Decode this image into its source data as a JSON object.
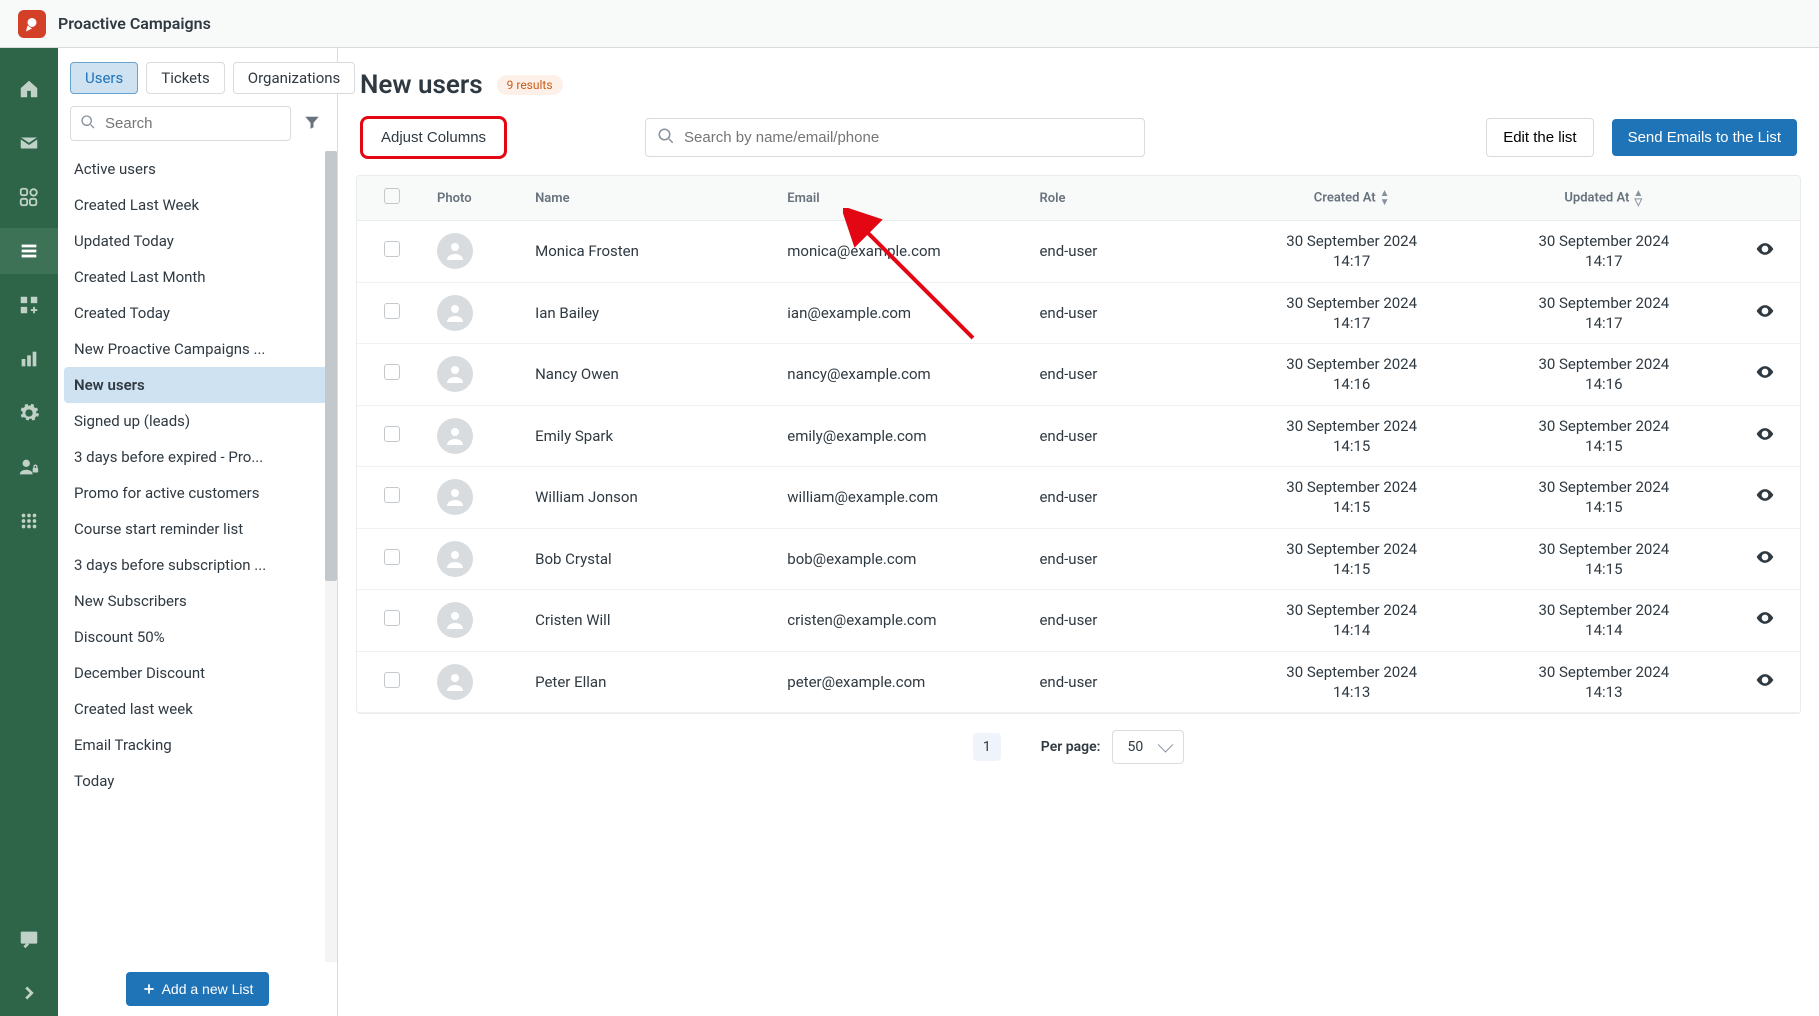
{
  "header": {
    "app_title": "Proactive Campaigns"
  },
  "sidebar": {
    "tabs": [
      "Users",
      "Tickets",
      "Organizations"
    ],
    "active_tab_index": 0,
    "search_placeholder": "Search",
    "add_list_label": "Add a new List",
    "items": [
      "Active users",
      "Created Last Week",
      "Updated Today",
      "Created Last Month",
      "Created Today",
      "New Proactive Campaigns ...",
      "New users",
      "Signed up (leads)",
      "3 days before expired - Pro...",
      "Promo for active customers",
      "Course start reminder list",
      "3 days before subscription ...",
      "New Subscribers",
      "Discount 50%",
      "December Discount",
      "Created last week",
      "Email Tracking",
      "Today"
    ],
    "selected_index": 6
  },
  "main": {
    "title": "New users",
    "result_badge": "9 results",
    "adjust_columns": "Adjust Columns",
    "search_placeholder": "Search by name/email/phone",
    "edit_list": "Edit the list",
    "send_emails": "Send Emails to the List",
    "columns": {
      "photo": "Photo",
      "name": "Name",
      "email": "Email",
      "role": "Role",
      "created": "Created At",
      "updated": "Updated At"
    },
    "rows": [
      {
        "name": "Monica Frosten",
        "email": "monica@example.com",
        "role": "end-user",
        "created": "30 September 2024\n14:17",
        "updated": "30 September 2024\n14:17"
      },
      {
        "name": "Ian Bailey",
        "email": "ian@example.com",
        "role": "end-user",
        "created": "30 September 2024\n14:17",
        "updated": "30 September 2024\n14:17"
      },
      {
        "name": "Nancy Owen",
        "email": "nancy@example.com",
        "role": "end-user",
        "created": "30 September 2024\n14:16",
        "updated": "30 September 2024\n14:16"
      },
      {
        "name": "Emily Spark",
        "email": "emily@example.com",
        "role": "end-user",
        "created": "30 September 2024\n14:15",
        "updated": "30 September 2024\n14:15"
      },
      {
        "name": "William Jonson",
        "email": "william@example.com",
        "role": "end-user",
        "created": "30 September 2024\n14:15",
        "updated": "30 September 2024\n14:15"
      },
      {
        "name": "Bob Crystal",
        "email": "bob@example.com",
        "role": "end-user",
        "created": "30 September 2024\n14:15",
        "updated": "30 September 2024\n14:15"
      },
      {
        "name": "Cristen Will",
        "email": "cristen@example.com",
        "role": "end-user",
        "created": "30 September 2024\n14:14",
        "updated": "30 September 2024\n14:14"
      },
      {
        "name": "Peter Ellan",
        "email": "peter@example.com",
        "role": "end-user",
        "created": "30 September 2024\n14:13",
        "updated": "30 September 2024\n14:13"
      }
    ]
  },
  "pager": {
    "page": "1",
    "per_page_label": "Per page:",
    "per_page_value": "50"
  }
}
